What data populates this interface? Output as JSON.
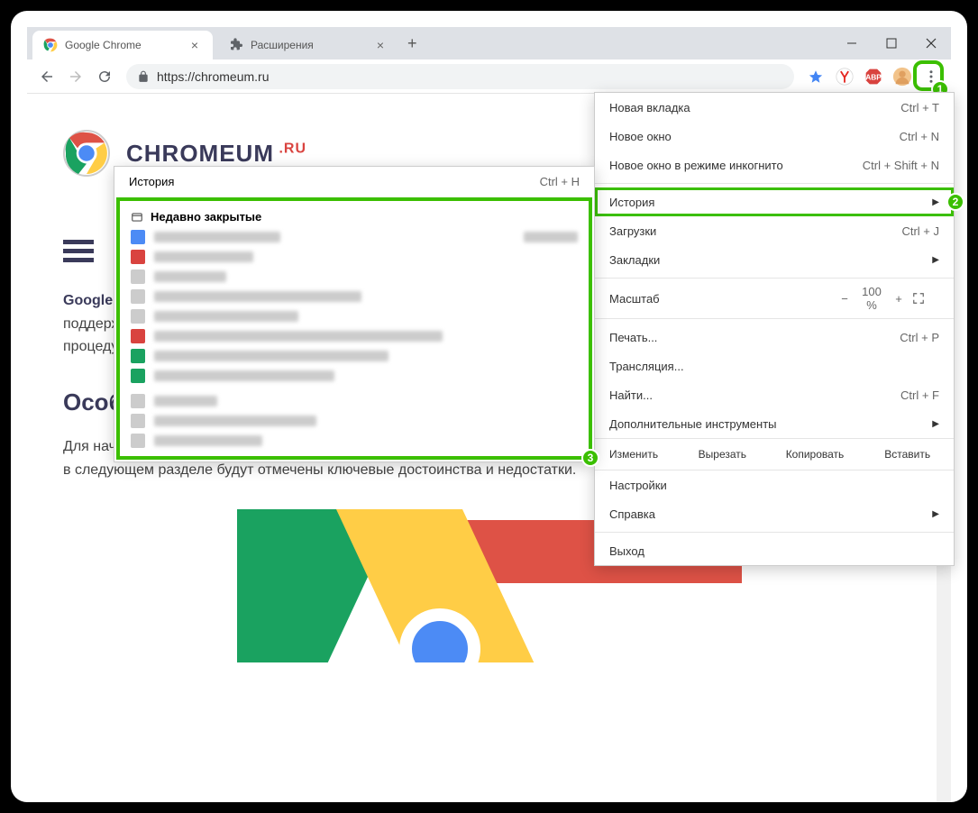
{
  "tabs": [
    {
      "title": "Google Chrome",
      "active": true
    },
    {
      "title": "Расширения",
      "active": false
    }
  ],
  "url": "https://chromeum.ru",
  "site": {
    "title_main": "CHROMEUM",
    "title_suffix": " .RU"
  },
  "article": {
    "lead_prefix": "Google Chrome",
    "lead_rest": " — как для ПК ... Его популярность легко объясняется совокупностью факторов, основной из которых – поддержка компании с мировым именем. Мы рассмотрим его особенности, краткую историю возникновения, а также процедуру установки для различных устройств. Приятного ознакомления с нашим материалом.",
    "h2": "Особенности",
    "p2": "Для начала мы предлагаем вам прочитать про системные требования для интернет-обозревателя на разных платформах. А в следующем разделе будут отмечены ключевые достоинства и недостатки."
  },
  "menu": {
    "new_tab": "Новая вкладка",
    "new_tab_sc": "Ctrl + T",
    "new_window": "Новое окно",
    "new_window_sc": "Ctrl + N",
    "incognito": "Новое окно в режиме инкогнито",
    "incognito_sc": "Ctrl + Shift + N",
    "history": "История",
    "downloads": "Загрузки",
    "downloads_sc": "Ctrl + J",
    "bookmarks": "Закладки",
    "zoom_label": "Масштаб",
    "zoom_minus": "−",
    "zoom_value": "100 %",
    "zoom_plus": "+",
    "print": "Печать...",
    "print_sc": "Ctrl + P",
    "cast": "Трансляция...",
    "find": "Найти...",
    "find_sc": "Ctrl + F",
    "more_tools": "Дополнительные инструменты",
    "edit_label": "Изменить",
    "cut": "Вырезать",
    "copy": "Копировать",
    "paste": "Вставить",
    "settings": "Настройки",
    "help": "Справка",
    "exit": "Выход"
  },
  "history_submenu": {
    "title": "История",
    "shortcut": "Ctrl + H",
    "recently_closed": "Недавно закрытые"
  },
  "callouts": {
    "one": "1",
    "two": "2",
    "three": "3"
  },
  "colors": {
    "accent": "#3bbf00"
  }
}
